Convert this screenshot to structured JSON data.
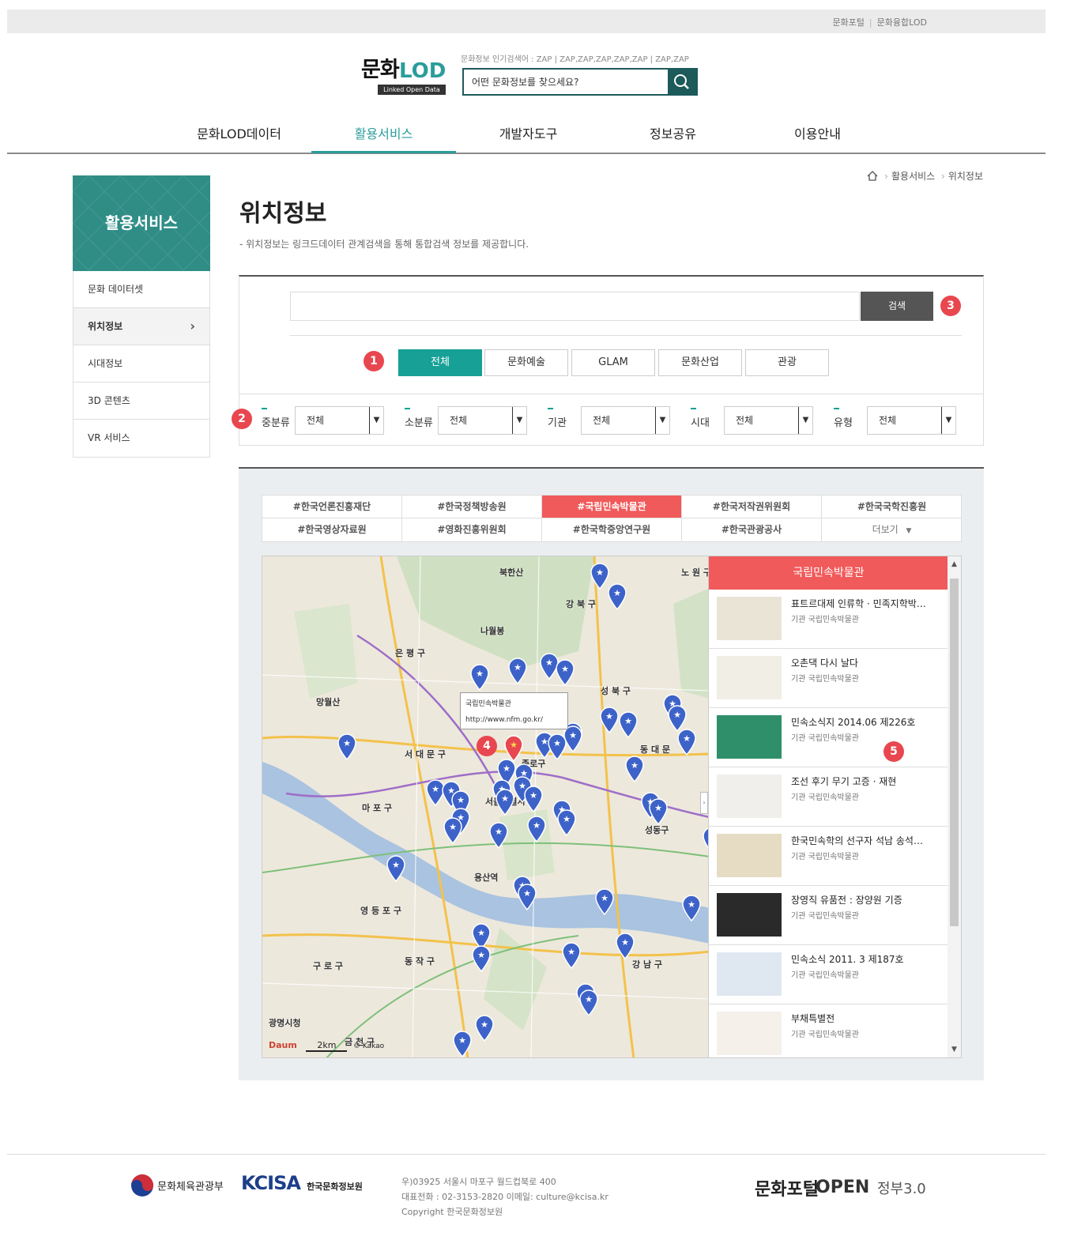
{
  "topbar": {
    "links": [
      "문화포털",
      "문화융합LOD"
    ]
  },
  "logo": {
    "main": "문화",
    "lod": "LOD",
    "sub": "Linked Open Data"
  },
  "search": {
    "popular": "문화정보 인기검색어 : ZAP | ZAP,ZAP,ZAP,ZAP,ZAP | ZAP,ZAP",
    "placeholder": "어떤 문화정보를 찾으세요?"
  },
  "gnb": [
    "문화LOD데이터",
    "활용서비스",
    "개발자도구",
    "정보공유",
    "이용안내"
  ],
  "lnb": {
    "title": "활용서비스",
    "items": [
      "문화 데이터셋",
      "위치정보",
      "시대정보",
      "3D 콘텐츠",
      "VR 서비스"
    ]
  },
  "breadcrumb": {
    "items": [
      "활용서비스",
      "위치정보"
    ]
  },
  "page": {
    "title": "위치정보",
    "desc": "- 위치정보는 링크드데이터 관계검색을 통해 통합검색 정보를 제공합니다."
  },
  "filter": {
    "search_label": "검색",
    "categories": [
      "전체",
      "문화예술",
      "GLAM",
      "문화산업",
      "관광"
    ],
    "selects": [
      {
        "label": "중분류",
        "value": "전체"
      },
      {
        "label": "소분류",
        "value": "전체"
      },
      {
        "label": "기관",
        "value": "전체"
      },
      {
        "label": "시대",
        "value": "전체"
      },
      {
        "label": "유형",
        "value": "전체"
      }
    ]
  },
  "badges": [
    "1",
    "2",
    "3",
    "4",
    "5"
  ],
  "institutions": [
    "#한국언론진흥재단",
    "#한국정책방송원",
    "#국립민속박물관",
    "#한국저작권위원회",
    "#한국국학진흥원",
    "#한국영상자료원",
    "#영화진흥위원회",
    "#한국학중앙연구원",
    "#한국관광공사",
    "더보기"
  ],
  "map": {
    "popup_name": "국립민속박물관",
    "popup_url": "http://www.nfm.go.kr/",
    "labels": [
      "북한산",
      "강 북 구",
      "은 평 구",
      "성 북 구",
      "서 대 문 구",
      "종로구",
      "동 대 문",
      "서울특별시",
      "마 포 구",
      "성동구",
      "영 등 포 구",
      "용산역",
      "동 작 구",
      "강 남 구",
      "구 로 구",
      "광명시청",
      "금 천 구",
      "망월산",
      "나월봉",
      "노 원 구"
    ],
    "scale": "2km",
    "brand": "Daum",
    "copyright": "© Kakao"
  },
  "panel": {
    "title": "국립민속박물관",
    "items": [
      {
        "title": "표트르대제 인류학 · 민족지학박…",
        "org": "기관 국립민속박물관"
      },
      {
        "title": "오촌댁 다시 날다",
        "org": "기관 국립민속박물관"
      },
      {
        "title": "민속소식지 2014.06 제226호",
        "org": "기관 국립민속박물관"
      },
      {
        "title": "조선 후기 무기 고증 · 재현",
        "org": "기관 국립민속박물관"
      },
      {
        "title": "한국민속학의 선구자 석남 송석…",
        "org": "기관 국립민속박물관"
      },
      {
        "title": "장영직 유품전 : 장양원 기증",
        "org": "기관 국립민속박물관"
      },
      {
        "title": "민속소식 2011. 3 제187호",
        "org": "기관 국립민속박물관"
      },
      {
        "title": "부채특별전",
        "org": "기관 국립민속박물관"
      }
    ]
  },
  "footer": {
    "ministry": "문화체육관광부",
    "kcisa": "KCISA",
    "kcisa_sub": "한국문화정보원",
    "address": "우)03925 서울시 마포구 월드컵북로 400",
    "contact": "대표전화 : 02-3153-2820 이메일: culture@kcisa.kr",
    "copyright": "Copyright 한국문화정보원",
    "portal": "문화포털",
    "open": "OPEN",
    "gov": "정부3.0"
  }
}
